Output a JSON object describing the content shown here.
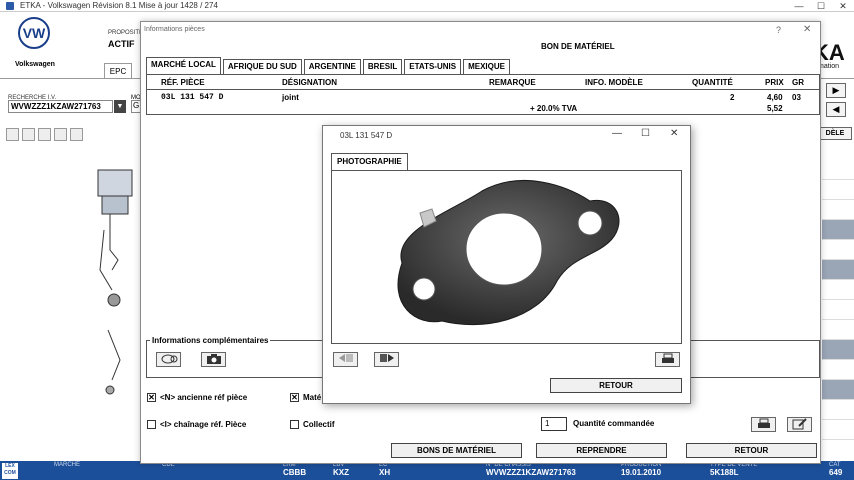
{
  "window": {
    "title": "ETKA - Volkswagen Révision 8.1 Mise à jour 1428 / 274",
    "min": "—",
    "max": "☐",
    "close": "✕"
  },
  "header": {
    "brand": "Volkswagen",
    "logo_text": "VW",
    "proposition": "PROPOSITIO",
    "actif": "ACTIF",
    "etka_right": "KA",
    "etka_right_sub": "mation",
    "epc_tab": "EPC"
  },
  "left": {
    "search_label": "RECHERCHE I.V.",
    "vin": "WVWZZZ1KZAW271763",
    "m_label": "MO",
    "g_value": "G"
  },
  "right": {
    "modele_button": "DÈLE",
    "arrow_buttons": [
      "▶",
      "◀",
      "▶"
    ]
  },
  "dialog": {
    "title": "Informations pièces",
    "help": "?",
    "close": "✕",
    "heading": "BON DE MATÉRIEL",
    "tabs": [
      "MARCHÉ LOCAL",
      "AFRIQUE DU SUD",
      "ARGENTINE",
      "BRESIL",
      "ETATS-UNIS",
      "MEXIQUE"
    ],
    "columns": {
      "ref": "RÉF. PIÈCE",
      "designation": "DÉSIGNATION",
      "remarque": "REMARQUE",
      "info": "INFO. MODÈLE",
      "quantite": "QUANTITÉ",
      "prix": "PRIX",
      "gr": "GR"
    },
    "row": {
      "ref": "03L  131  547  D",
      "designation": "joint",
      "quantite": "2",
      "prix": "4,60",
      "gr": "03"
    },
    "tva_label": "+ 20.0% TVA",
    "tva_price": "5,52",
    "infos_label": "Informations complémentaires",
    "chk_ancienne": "<N> ancienne réf pièce",
    "chk_ancienne_mark": "✕",
    "chk_chainage": "<I> chaînage réf. Pièce",
    "chk_mate": "Maté",
    "chk_mate_mark": "✕",
    "chk_collectif": "Collectif",
    "qty_value": "1",
    "qty_label": "Quantité commandée",
    "btn_bons": "BONS DE MATÉRIEL",
    "btn_reprendre": "REPRENDRE",
    "btn_retour": "RETOUR"
  },
  "photo": {
    "title": "03L 131 547 D",
    "min": "—",
    "max": "☐",
    "close": "✕",
    "tab": "PHOTOGRAPHIE",
    "retour": "RETOUR"
  },
  "status": {
    "lexcom": "LEX COM",
    "cells": [
      {
        "label": "MARCHÉ",
        "value": ""
      },
      {
        "label": "CDE",
        "value": ""
      },
      {
        "label": "LRM",
        "value": "CBBB"
      },
      {
        "label": "LBV",
        "value": "KXZ"
      },
      {
        "label": "EC",
        "value": "XH"
      },
      {
        "label": "N° DE CHÂSSIS",
        "value": "WVWZZZ1KZAW271763"
      },
      {
        "label": "PRODUCTION",
        "value": "19.01.2010"
      },
      {
        "label": "TYPE DE VENTE",
        "value": "5K188L"
      },
      {
        "label": "CAT",
        "value": "649"
      }
    ]
  },
  "colors": {
    "status_bar": "#1c4f9a",
    "vw_blue": "#1a3f8a"
  }
}
